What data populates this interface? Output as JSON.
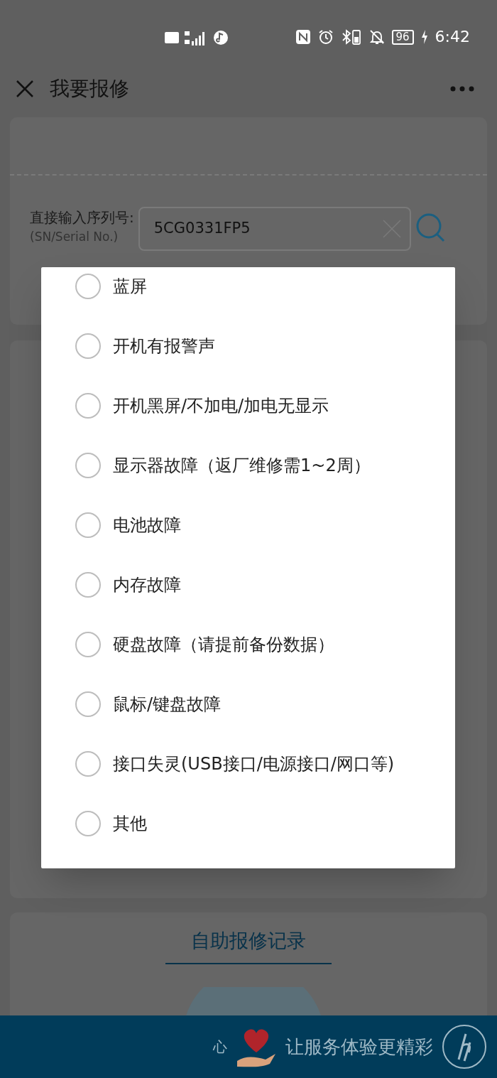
{
  "status_bar": {
    "time": "6:42",
    "battery": "96"
  },
  "app_bar": {
    "title": "我要报修"
  },
  "serial": {
    "label": "直接输入序列号:",
    "sublabel": "(SN/Serial No.)",
    "value": "5CG0331FP5"
  },
  "fault_options": [
    {
      "label": "蓝屏",
      "selected": false
    },
    {
      "label": "开机有报警声",
      "selected": false
    },
    {
      "label": "开机黑屏/不加电/加电无显示",
      "selected": false
    },
    {
      "label": "显示器故障（返厂维修需1~2周）",
      "selected": false
    },
    {
      "label": "电池故障",
      "selected": false
    },
    {
      "label": "内存故障",
      "selected": false
    },
    {
      "label": "硬盘故障（请提前备份数据）",
      "selected": false
    },
    {
      "label": "鼠标/键盘故障",
      "selected": false
    },
    {
      "label": "接口失灵(USB接口/电源接口/网口等)",
      "selected": false
    },
    {
      "label": "其他",
      "selected": false
    }
  ],
  "records_link": "自助报修记录",
  "banner": {
    "lead": "心",
    "slogan": "让服务体验更精彩"
  }
}
